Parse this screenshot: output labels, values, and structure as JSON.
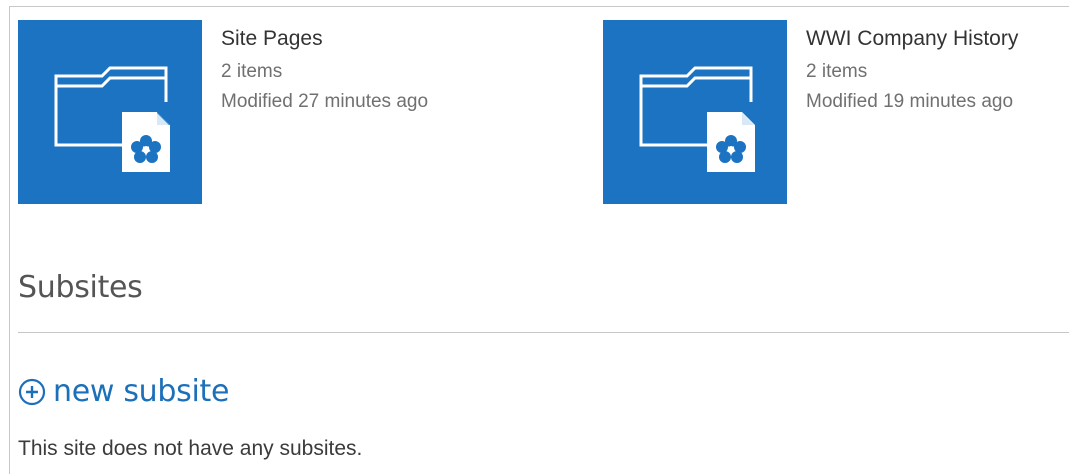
{
  "tiles": [
    {
      "title": "Site Pages",
      "item_count": "2 items",
      "modified": "Modified 27 minutes ago",
      "icon": "folder-with-page-icon"
    },
    {
      "title": "WWI Company History",
      "item_count": "2 items",
      "modified": "Modified 19 minutes ago",
      "icon": "folder-with-page-icon"
    }
  ],
  "subsites": {
    "heading": "Subsites",
    "new_label": "new subsite",
    "new_icon": "plus-circle-icon",
    "empty_message": "This site does not have any subsites."
  },
  "colors": {
    "tile_background": "#1b73c2",
    "link_blue": "#1c6fb9"
  }
}
